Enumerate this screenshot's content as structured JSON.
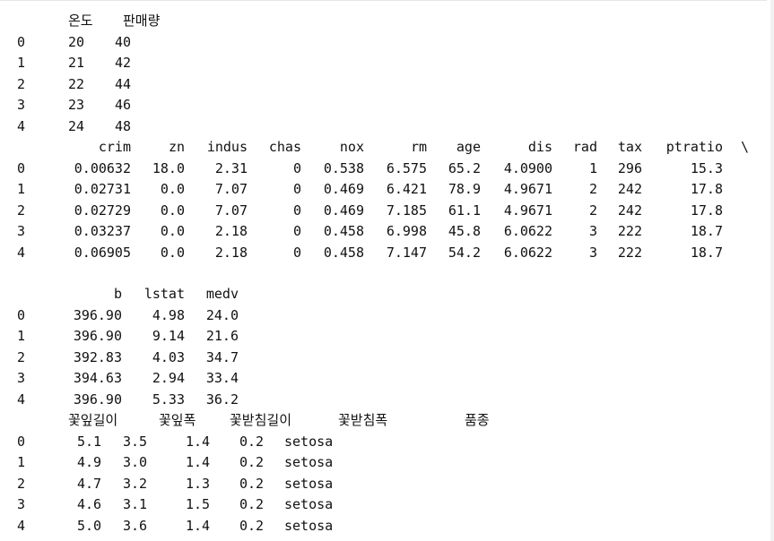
{
  "df_sales": {
    "columns": [
      "온도",
      "판매량"
    ],
    "rows": [
      [
        "0",
        "20",
        "40"
      ],
      [
        "1",
        "21",
        "42"
      ],
      [
        "2",
        "22",
        "44"
      ],
      [
        "3",
        "23",
        "46"
      ],
      [
        "4",
        "24",
        "48"
      ]
    ]
  },
  "df_boston_part1": {
    "columns": [
      "crim",
      "zn",
      "indus",
      "chas",
      "nox",
      "rm",
      "age",
      "dis",
      "rad",
      "tax",
      "ptratio",
      "\\"
    ],
    "rows": [
      [
        "0",
        "0.00632",
        "18.0",
        "2.31",
        "0",
        "0.538",
        "6.575",
        "65.2",
        "4.0900",
        "1",
        "296",
        "15.3"
      ],
      [
        "1",
        "0.02731",
        "0.0",
        "7.07",
        "0",
        "0.469",
        "6.421",
        "78.9",
        "4.9671",
        "2",
        "242",
        "17.8"
      ],
      [
        "2",
        "0.02729",
        "0.0",
        "7.07",
        "0",
        "0.469",
        "7.185",
        "61.1",
        "4.9671",
        "2",
        "242",
        "17.8"
      ],
      [
        "3",
        "0.03237",
        "0.0",
        "2.18",
        "0",
        "0.458",
        "6.998",
        "45.8",
        "6.0622",
        "3",
        "222",
        "18.7"
      ],
      [
        "4",
        "0.06905",
        "0.0",
        "2.18",
        "0",
        "0.458",
        "7.147",
        "54.2",
        "6.0622",
        "3",
        "222",
        "18.7"
      ]
    ]
  },
  "df_boston_part2": {
    "columns": [
      "b",
      "lstat",
      "medv"
    ],
    "rows": [
      [
        "0",
        "396.90",
        "4.98",
        "24.0"
      ],
      [
        "1",
        "396.90",
        "9.14",
        "21.6"
      ],
      [
        "2",
        "392.83",
        "4.03",
        "34.7"
      ],
      [
        "3",
        "394.63",
        "2.94",
        "33.4"
      ],
      [
        "4",
        "396.90",
        "5.33",
        "36.2"
      ]
    ]
  },
  "df_iris": {
    "columns": [
      "꽃잎길이",
      "꽃잎폭",
      "꽃받침길이",
      "꽃받침폭",
      "품종"
    ],
    "rows": [
      [
        "0",
        "5.1",
        "3.5",
        "1.4",
        "0.2",
        "setosa"
      ],
      [
        "1",
        "4.9",
        "3.0",
        "1.4",
        "0.2",
        "setosa"
      ],
      [
        "2",
        "4.7",
        "3.2",
        "1.3",
        "0.2",
        "setosa"
      ],
      [
        "3",
        "4.6",
        "3.1",
        "1.5",
        "0.2",
        "setosa"
      ],
      [
        "4",
        "5.0",
        "3.6",
        "1.4",
        "0.2",
        "setosa"
      ]
    ]
  }
}
